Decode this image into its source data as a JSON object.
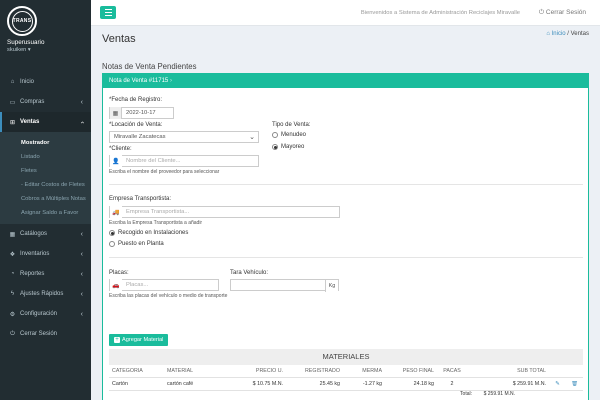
{
  "sidebar": {
    "logo_text": "TRANS",
    "user_name": "Superusuario",
    "user_sub": "skuiken ▾",
    "menu": [
      {
        "label": "Inicio",
        "icon": "home-icon",
        "glyph": "⌂"
      },
      {
        "label": "Compras",
        "icon": "credit-card-icon",
        "glyph": "▭"
      },
      {
        "label": "Ventas",
        "icon": "cart-icon",
        "glyph": "🛒"
      }
    ],
    "ventas_sub": [
      "Mostrador",
      "Listado",
      "Fletes",
      "- Editar Costos de Fletes",
      "Cobros a Múltiples Notas",
      "Asignar Saldo a Favor"
    ],
    "menu_bottom": [
      {
        "label": "Catálogos",
        "icon": "grid-icon",
        "glyph": "▦"
      },
      {
        "label": "Inventarios",
        "icon": "cubes-icon",
        "glyph": "❖"
      },
      {
        "label": "Reportes",
        "icon": "chart-icon",
        "glyph": "◔"
      },
      {
        "label": "Ajustes Rápidos",
        "icon": "bolt-icon",
        "glyph": "ϟ"
      },
      {
        "label": "Configuración",
        "icon": "gear-icon",
        "glyph": "⚙"
      },
      {
        "label": "Cerrar Sesión",
        "icon": "power-icon",
        "glyph": "⏻"
      }
    ]
  },
  "topbar": {
    "welcome": "Bienvenidos a Sistema de Administración Reciclajes Miravalle",
    "logout": "Cerrar Sesión"
  },
  "header": {
    "title": "Ventas",
    "crumb_home": "Inicio",
    "crumb_sep": " / ",
    "crumb_current": "Ventas"
  },
  "section_title": "Notas de Venta Pendientes",
  "card_title": "Nota de Venta #11715",
  "form": {
    "fecha_label": "*Fecha de Registro:",
    "fecha_value": "2022-10-17",
    "locacion_label": "*Locación de Venta:",
    "locacion_value": "Miravalle Zacatecas",
    "cliente_label": "*Cliente:",
    "cliente_placeholder": "Nombre del Cliente...",
    "cliente_help": "Escriba el nombre del proveedor para seleccionar",
    "tipo_label": "Tipo de Venta:",
    "tipo_options": [
      "Menudeo",
      "Mayoreo"
    ],
    "transportista_label": "Empresa Transportista:",
    "transportista_placeholder": "Empresa Transportista...",
    "transportista_help": "Escriba la Empresa Transportista a añadir",
    "entrega_options": [
      "Recogido en Instalaciones",
      "Puesto en Planta"
    ],
    "placas_label": "Placas:",
    "placas_placeholder": "Placas...",
    "placas_help": "Escriba las placas del vehículo o medio de transporte",
    "tara_label": "Tara Vehículo:",
    "tara_unit": "Kg"
  },
  "add_button": "Agregar Material",
  "table": {
    "title": "MATERIALES",
    "headers": [
      "CATEGORÍA",
      "MATERIAL",
      "PRECIO U.",
      "REGISTRADO",
      "MERMA",
      "PESO FINAL",
      "PACAS",
      "SUB TOTAL"
    ],
    "rows": [
      [
        "Cartón",
        "cartón café",
        "$ 10.75 M.N.",
        "25.45 kg",
        "-1.27 kg",
        "24.18 kg",
        "2",
        "$ 259.91 M.N."
      ]
    ],
    "total_label": "Total:",
    "total_value": "$ 259.91 M.N."
  },
  "colors": {
    "accent": "#1abc9c",
    "sidebar": "#222d32",
    "link": "#3c8dbc"
  }
}
